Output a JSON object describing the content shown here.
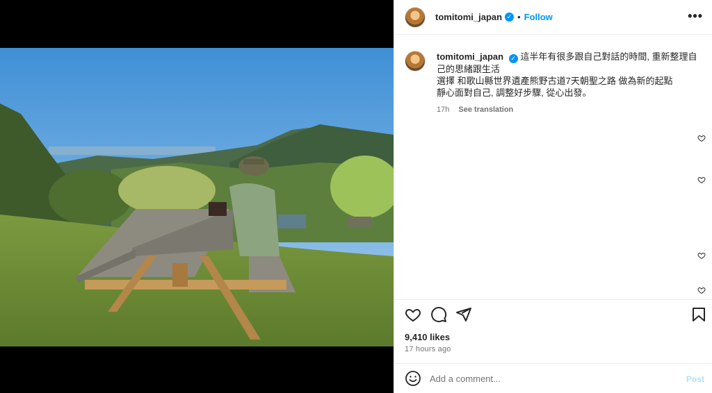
{
  "post": {
    "username": "tomitomi_japan",
    "verified_mark": "✓",
    "separator": "•",
    "follow_label": "Follow",
    "more_label": "•••"
  },
  "caption": {
    "username": "tomitomi_japan",
    "line1": "這半年有很多跟自己對話的時間, 重新整理自己的思緒跟生活",
    "line2": "選擇 和歌山縣世界遺產熊野古道7天朝聖之路 做為新的起點",
    "line3": "靜心面對自己, 調整好步驟, 從心出發。",
    "age": "17h",
    "see_translation": "See translation"
  },
  "engagement": {
    "likes": "9,410 likes",
    "timestamp": "17 hours ago"
  },
  "comment": {
    "placeholder": "Add a comment...",
    "post_label": "Post"
  },
  "icons": {
    "like": "heart-icon",
    "comment": "comment-icon",
    "share": "share-icon",
    "save": "bookmark-icon",
    "emoji": "emoji-icon",
    "more": "more-options-icon"
  },
  "colors": {
    "accent": "#0095f6",
    "text": "#262626",
    "muted": "#737373",
    "post_disabled": "#b2dffc"
  }
}
